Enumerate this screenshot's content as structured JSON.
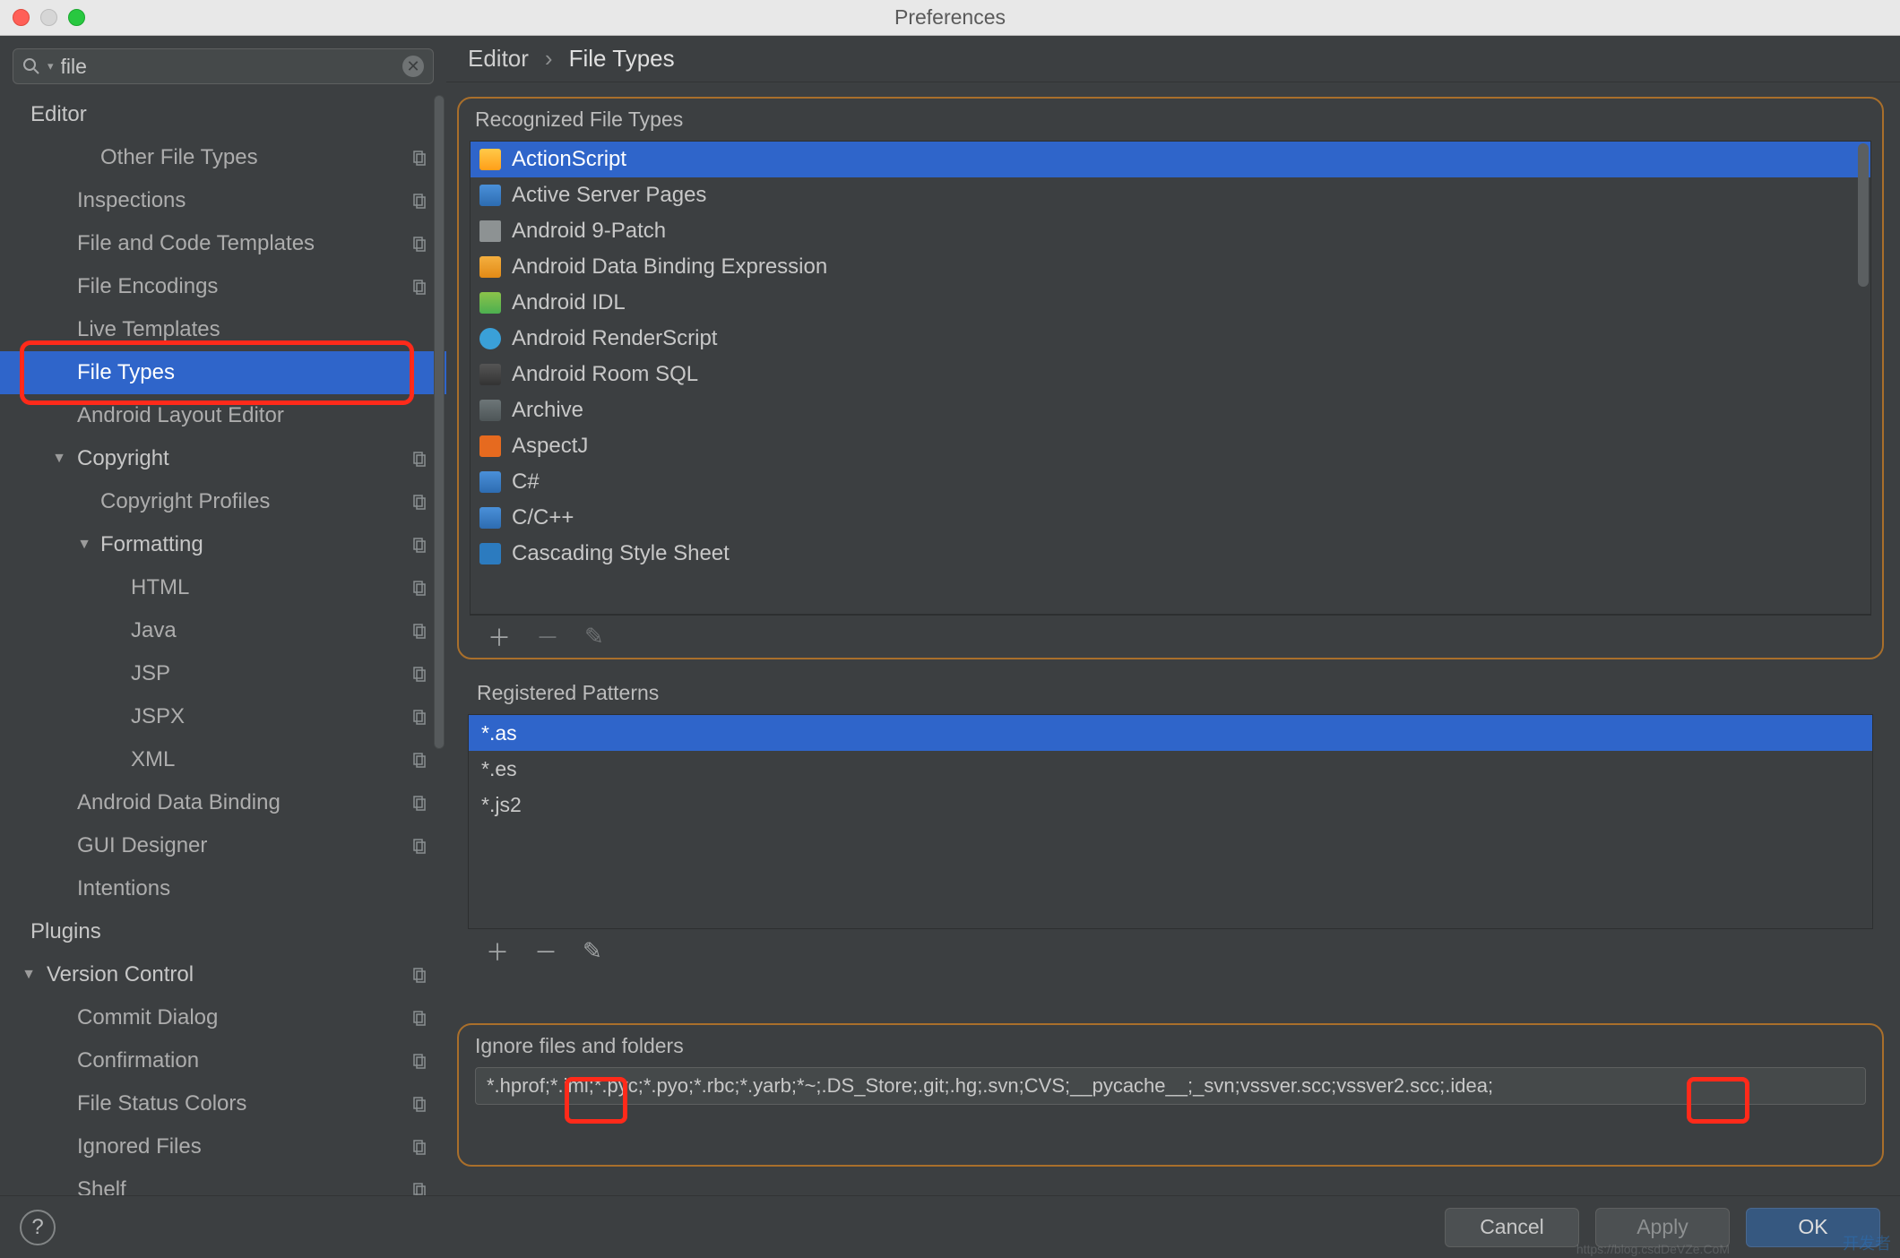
{
  "window": {
    "title": "Preferences"
  },
  "search": {
    "placeholder": "",
    "value": "file"
  },
  "breadcrumb": {
    "root": "Editor",
    "leaf": "File Types"
  },
  "tree": [
    {
      "label": "Editor",
      "indent": 34,
      "head": true,
      "arrow": "",
      "page": false
    },
    {
      "label": "Other File Types",
      "indent": 112,
      "page": true
    },
    {
      "label": "Inspections",
      "indent": 86,
      "page": true
    },
    {
      "label": "File and Code Templates",
      "indent": 86,
      "page": true
    },
    {
      "label": "File Encodings",
      "indent": 86,
      "page": true
    },
    {
      "label": "Live Templates",
      "indent": 86,
      "page": false
    },
    {
      "label": "File Types",
      "indent": 86,
      "selected": true,
      "page": false
    },
    {
      "label": "Android Layout Editor",
      "indent": 86,
      "page": false
    },
    {
      "label": "Copyright",
      "indent": 86,
      "head": true,
      "arrow": "▼",
      "arrowPos": 54,
      "page": true
    },
    {
      "label": "Copyright Profiles",
      "indent": 112,
      "page": true
    },
    {
      "label": "Formatting",
      "indent": 112,
      "head": true,
      "arrow": "▼",
      "arrowPos": 82,
      "page": true
    },
    {
      "label": "HTML",
      "indent": 146,
      "page": true
    },
    {
      "label": "Java",
      "indent": 146,
      "page": true
    },
    {
      "label": "JSP",
      "indent": 146,
      "page": true
    },
    {
      "label": "JSPX",
      "indent": 146,
      "page": true
    },
    {
      "label": "XML",
      "indent": 146,
      "page": true
    },
    {
      "label": "Android Data Binding",
      "indent": 86,
      "page": true
    },
    {
      "label": "GUI Designer",
      "indent": 86,
      "page": true
    },
    {
      "label": "Intentions",
      "indent": 86,
      "page": false
    },
    {
      "label": "Plugins",
      "indent": 34,
      "head": true,
      "page": false
    },
    {
      "label": "Version Control",
      "indent": 52,
      "head": true,
      "arrow": "▼",
      "arrowPos": 20,
      "page": true
    },
    {
      "label": "Commit Dialog",
      "indent": 86,
      "page": true
    },
    {
      "label": "Confirmation",
      "indent": 86,
      "page": true
    },
    {
      "label": "File Status Colors",
      "indent": 86,
      "page": true
    },
    {
      "label": "Ignored Files",
      "indent": 86,
      "page": true
    },
    {
      "label": "Shelf",
      "indent": 86,
      "page": true
    }
  ],
  "recognizedTitle": "Recognized File Types",
  "fileTypes": [
    {
      "label": "ActionScript",
      "icon": "ic-as",
      "selected": true
    },
    {
      "label": "Active Server Pages",
      "icon": "ic-asp"
    },
    {
      "label": "Android 9-Patch",
      "icon": "ic-folder"
    },
    {
      "label": "Android Data Binding Expression",
      "icon": "ic-db"
    },
    {
      "label": "Android IDL",
      "icon": "ic-idl"
    },
    {
      "label": "Android RenderScript",
      "icon": "ic-rs"
    },
    {
      "label": "Android Room SQL",
      "icon": "ic-sql"
    },
    {
      "label": "Archive",
      "icon": "ic-archive"
    },
    {
      "label": "AspectJ",
      "icon": "ic-aj"
    },
    {
      "label": "C#",
      "icon": "ic-cs"
    },
    {
      "label": "C/C++",
      "icon": "ic-cpp"
    },
    {
      "label": "Cascading Style Sheet",
      "icon": "ic-css"
    }
  ],
  "patternsTitle": "Registered Patterns",
  "patterns": [
    {
      "label": "*.as",
      "selected": true
    },
    {
      "label": "*.es"
    },
    {
      "label": "*.js2"
    }
  ],
  "ignoreTitle": "Ignore files and folders",
  "ignoreValue": "*.hprof;*.iml;*.pyc;*.pyo;*.rbc;*.yarb;*~;.DS_Store;.git;.hg;.svn;CVS;__pycache__;_svn;vssver.scc;vssver2.scc;.idea;",
  "buttons": {
    "cancel": "Cancel",
    "apply": "Apply",
    "ok": "OK",
    "help": "?"
  },
  "watermark": "开发者",
  "watermark2": "https://blog.csdDeVZe.CoM"
}
